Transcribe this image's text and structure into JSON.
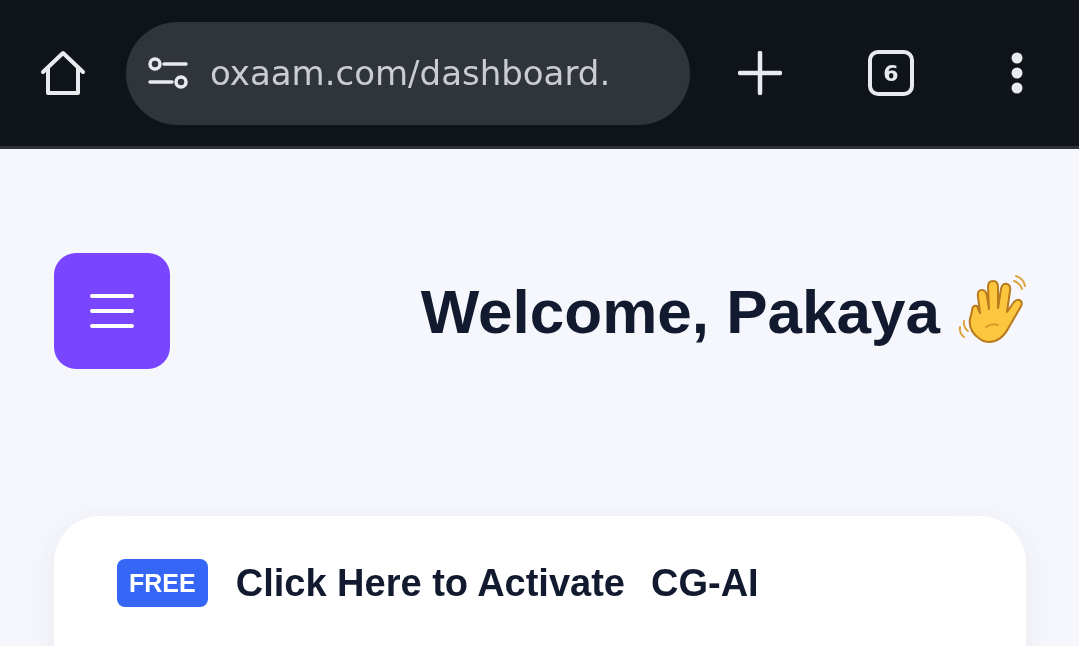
{
  "browser": {
    "url": "oxaam.com/dashboard.",
    "tab_count": "6"
  },
  "header": {
    "title": "Welcome, Pakaya"
  },
  "card": {
    "badge": "FREE",
    "link": {
      "text": "Click Here to Activate",
      "product": "CG-AI"
    }
  }
}
